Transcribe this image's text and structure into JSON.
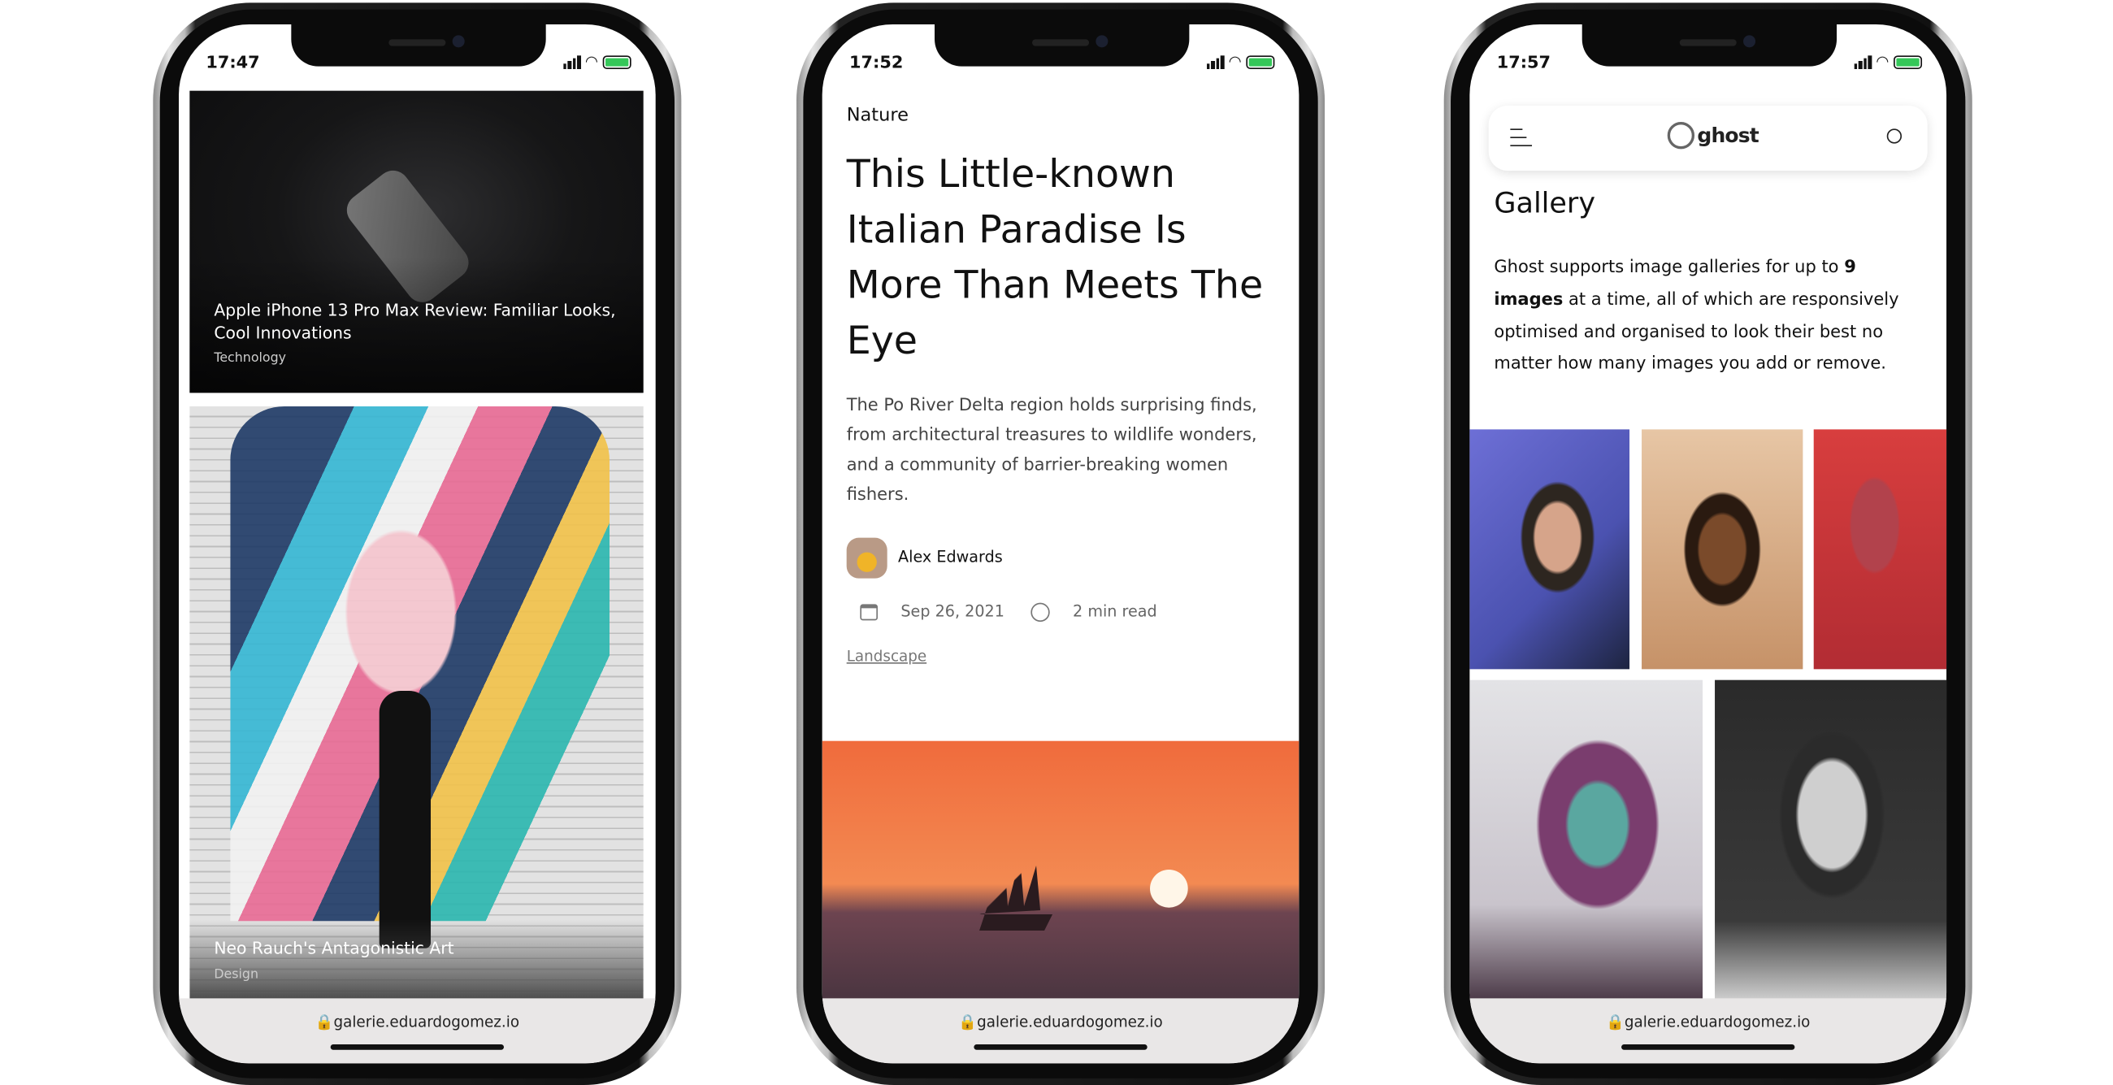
{
  "phones": [
    {
      "status_time": "17:47",
      "url": "galerie.eduardogomez.io",
      "cards": [
        {
          "title": "Apple iPhone 13 Pro Max Review: Familiar Looks, Cool Innovations",
          "category": "Technology"
        },
        {
          "title": "Neo Rauch's Antagonistic Art",
          "category": "Design"
        }
      ]
    },
    {
      "status_time": "17:52",
      "url": "galerie.eduardogomez.io",
      "tag": "Nature",
      "title": "This Little-known Italian Paradise Is More Than Meets The Eye",
      "excerpt": "The Po River Delta region holds surprising finds, from architectural treasures to wildlife wonders, and a community of barrier-breaking women fishers.",
      "author": "Alex Edwards",
      "date": "Sep 26, 2021",
      "read_time": "2 min read",
      "topic_link": "Landscape"
    },
    {
      "status_time": "17:57",
      "url": "galerie.eduardogomez.io",
      "logo_text": "ghost",
      "heading": "Gallery",
      "paragraph": {
        "before": "Ghost supports image galleries for up to ",
        "bold": "9 images",
        "after": " at a time, all of which are responsively optimised and organised to look their best no matter how many images you add or remove."
      }
    }
  ],
  "icons": {
    "menu": "hamburger-icon",
    "search": "search-icon",
    "calendar": "calendar-icon",
    "clock": "clock-icon",
    "lock": "lock-icon"
  }
}
